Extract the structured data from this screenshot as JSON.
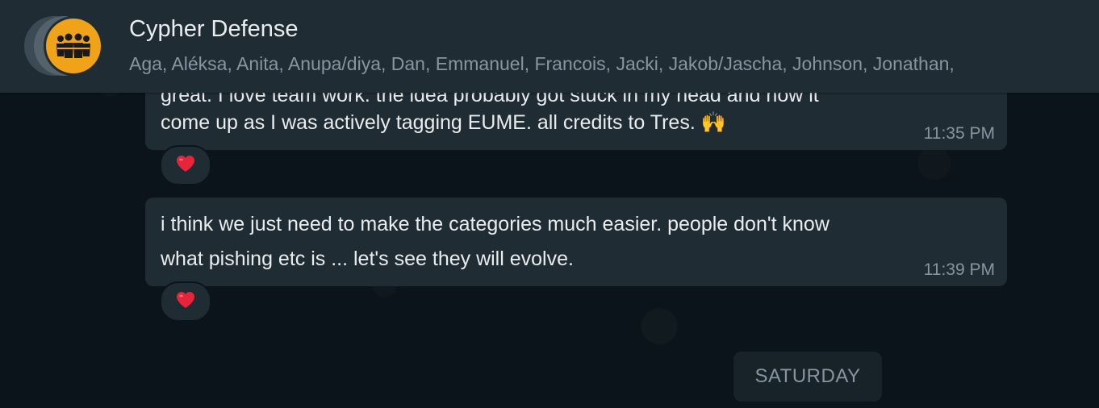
{
  "header": {
    "title": "Cypher Defense",
    "members": "Aga, Aléksa, Anita, Anupa/diya, Dan, Emmanuel, Francois, Jacki, Jakob/Jascha, Johnson, Jonathan,"
  },
  "messages": [
    {
      "line_partial": "great. I love team work. the idea probably got stuck in my head and now it",
      "line2": "come up as I was actively tagging EUME. all credits to Tres. 🙌",
      "time": "11:35 PM",
      "reaction": "❤️"
    },
    {
      "line1": "i think we just need to make the categories much easier. people don't know",
      "line2": "what pishing etc is ... let's see they will evolve.",
      "time": "11:39 PM",
      "reaction": "❤️"
    }
  ],
  "date_divider": "SATURDAY",
  "colors": {
    "header_bg": "#202c33",
    "chat_bg": "#0b141a",
    "bubble_bg": "#202c33",
    "avatar_bg": "#f0a218",
    "secondary_text": "#8696a0"
  },
  "icons": {
    "avatar": "group-avatar-icon",
    "reaction": "heart-icon"
  }
}
